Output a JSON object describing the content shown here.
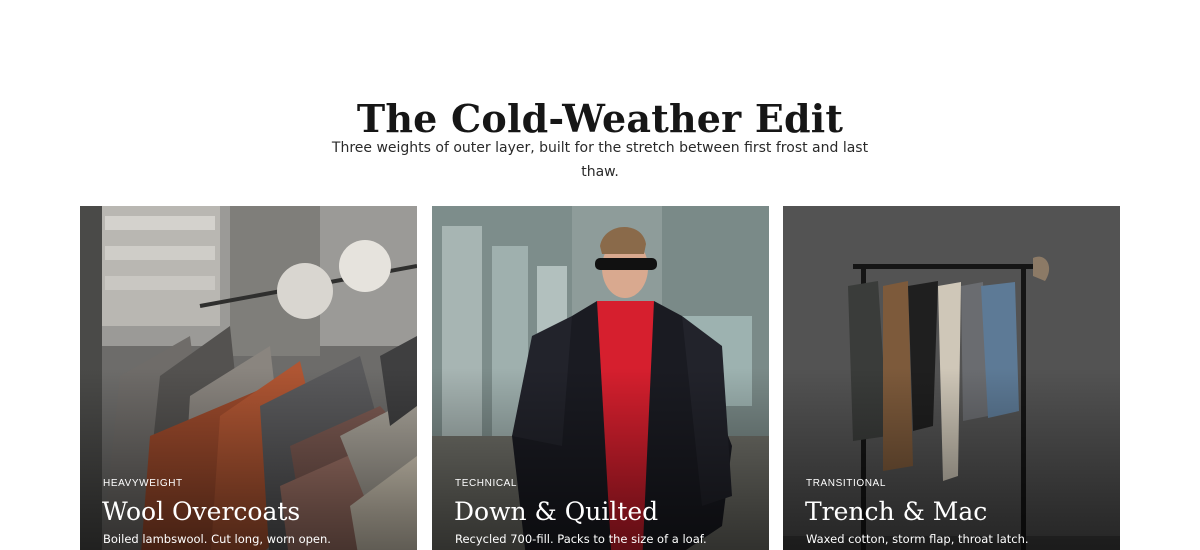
{
  "section": {
    "title": "The Cold-Weather Edit",
    "subtitle": "Three weights of outer layer, built for the stretch between first frost and last thaw."
  },
  "cards": [
    {
      "eyebrow": "HEAVYWEIGHT",
      "title": "Wool Overcoats",
      "description": "Boiled lambswool. Cut long, worn open.",
      "image": "clothing-rack-photo"
    },
    {
      "eyebrow": "TECHNICAL",
      "title": "Down & Quilted",
      "description": "Recycled 700-fill. Packs to the size of a loaf.",
      "image": "man-in-quilted-jacket-photo"
    },
    {
      "eyebrow": "TRANSITIONAL",
      "title": "Trench & Mac",
      "description": "Waxed cotton, storm flap, throat latch.",
      "image": "coats-on-garment-rack-photo"
    }
  ],
  "colors": {
    "background": "#ffffff",
    "heading": "#161616",
    "overlay_text": "#ffffff",
    "jacket_red": "#d61f2e"
  }
}
